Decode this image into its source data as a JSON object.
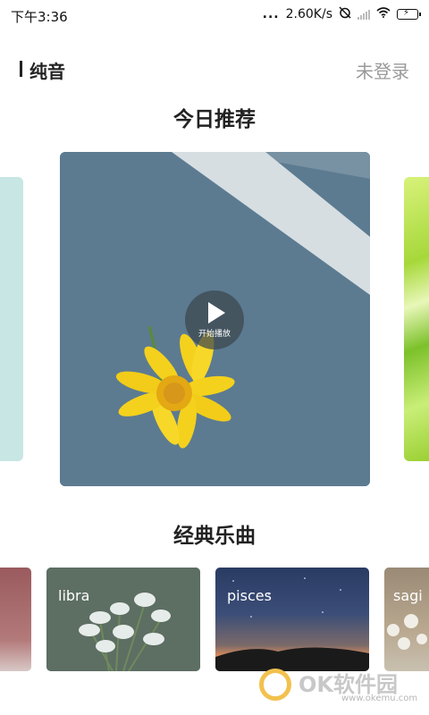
{
  "status_bar": {
    "time": "下午3:36",
    "dots": "...",
    "network_speed": "2.60K/s"
  },
  "header": {
    "title": "纯音",
    "login": "未登录"
  },
  "today": {
    "title": "今日推荐",
    "play_label": "开始播放"
  },
  "classic": {
    "title": "经典乐曲",
    "tracks": [
      {
        "name": "libra"
      },
      {
        "name": "pisces"
      },
      {
        "name": "sagi"
      }
    ]
  },
  "watermark": {
    "brand": "OK软件园",
    "url": "www.okemu.com"
  }
}
